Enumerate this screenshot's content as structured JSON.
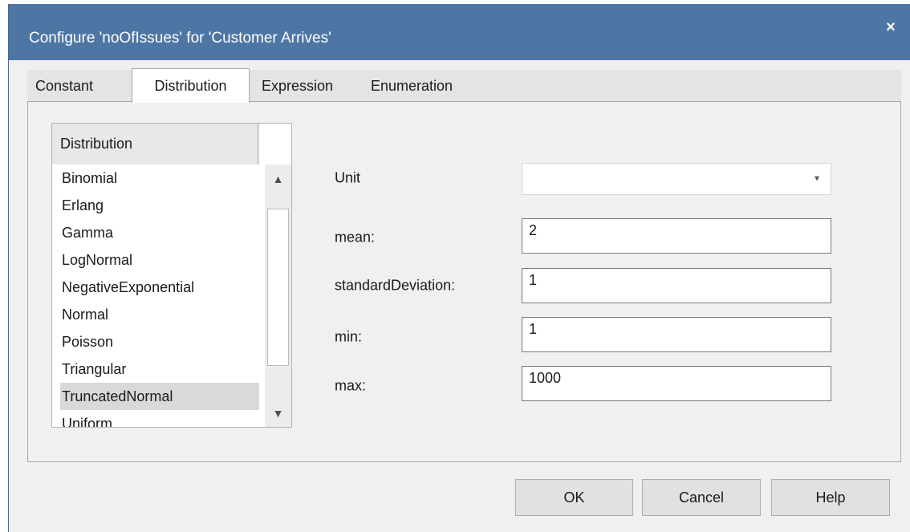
{
  "window": {
    "title": "Configure 'noOfIssues' for 'Customer Arrives'",
    "close_glyph": "×",
    "title_bar_color": "#4e76a4"
  },
  "tabs": [
    {
      "label": "Constant",
      "active": false
    },
    {
      "label": "Distribution",
      "active": true
    },
    {
      "label": "Expression",
      "active": false
    },
    {
      "label": "Enumeration",
      "active": false
    }
  ],
  "distribution_list": {
    "header": "Distribution",
    "items": [
      "Binomial",
      "Erlang",
      "Gamma",
      "LogNormal",
      "NegativeExponential",
      "Normal",
      "Poisson",
      "Triangular",
      "TruncatedNormal",
      "Uniform"
    ],
    "selected": "TruncatedNormal",
    "scroll_up_glyph": "▲",
    "scroll_down_glyph": "▼"
  },
  "fields": {
    "unit": {
      "label": "Unit",
      "value": "",
      "arrow_glyph": "▼"
    },
    "mean": {
      "label": "mean:",
      "value": "2"
    },
    "standard_deviation": {
      "label": "standardDeviation:",
      "value": "1"
    },
    "min": {
      "label": "min:",
      "value": "1"
    },
    "max": {
      "label": "max:",
      "value": "1000"
    }
  },
  "buttons": {
    "ok": "OK",
    "cancel": "Cancel",
    "help": "Help"
  },
  "icons": {
    "close": "close-icon",
    "scroll_up": "chevron-up-icon",
    "scroll_down": "chevron-down-icon",
    "dropdown": "chevron-down-icon"
  }
}
